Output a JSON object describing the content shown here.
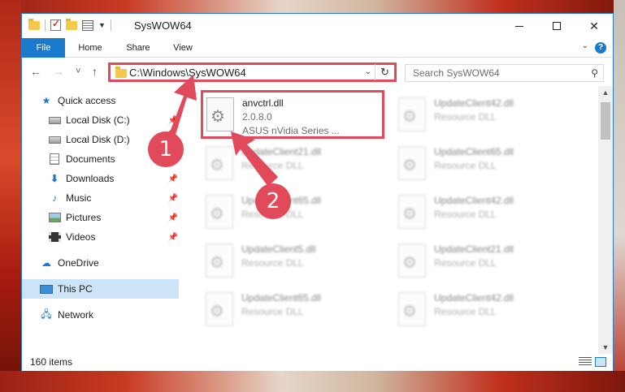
{
  "window": {
    "title": "SysWOW64",
    "minimize_glyph": "",
    "maximize_glyph": "",
    "close_glyph": "✕"
  },
  "ribbon": {
    "tabs": [
      "File",
      "Home",
      "Share",
      "View"
    ],
    "help_glyph": "?"
  },
  "navigation": {
    "back_glyph": "←",
    "forward_glyph": "→",
    "recent_glyph": "˅",
    "up_glyph": "↑",
    "address_path": "C:\\Windows\\SysWOW64",
    "refresh_glyph": "↻",
    "search_placeholder": "Search SysWOW64"
  },
  "sidebar": {
    "items": [
      {
        "label": "Quick access",
        "icon": "star-icon",
        "pinned": false
      },
      {
        "label": "Local Disk (C:)",
        "icon": "disk-icon",
        "pinned": true
      },
      {
        "label": "Local Disk (D:)",
        "icon": "disk-icon",
        "pinned": true
      },
      {
        "label": "Documents",
        "icon": "documents-icon",
        "pinned": true
      },
      {
        "label": "Downloads",
        "icon": "downloads-icon",
        "pinned": true
      },
      {
        "label": "Music",
        "icon": "music-icon",
        "pinned": true
      },
      {
        "label": "Pictures",
        "icon": "pictures-icon",
        "pinned": true
      },
      {
        "label": "Videos",
        "icon": "videos-icon",
        "pinned": true
      },
      {
        "label": "OneDrive",
        "icon": "onedrive-icon",
        "pinned": false
      },
      {
        "label": "This PC",
        "icon": "this-pc-icon",
        "pinned": false,
        "selected": true
      },
      {
        "label": "Network",
        "icon": "network-icon",
        "pinned": false
      }
    ]
  },
  "files": [
    {
      "name": "anvctrl.dll",
      "line2": "2.0.8.0",
      "line3": "ASUS nVidia Series ...",
      "highlighted": true
    },
    {
      "name": "UpdateClient42.dll",
      "line2": "Resource DLL"
    },
    {
      "name": "UpdateClient21.dll",
      "line2": "Resource DLL"
    },
    {
      "name": "UpdateClient65.dll",
      "line2": "Resource DLL"
    },
    {
      "name": "UpdateClient65.dll",
      "line2": "Resource DLL"
    },
    {
      "name": "UpdateClient42.dll",
      "line2": "Resource DLL"
    },
    {
      "name": "UpdateClient5.dll",
      "line2": "Resource DLL"
    },
    {
      "name": "UpdateClient21.dll",
      "line2": "Resource DLL"
    },
    {
      "name": "UpdateClient65.dll",
      "line2": "Resource DLL"
    },
    {
      "name": "UpdateClient42.dll",
      "line2": "Resource DLL"
    }
  ],
  "status": {
    "item_count": "160 items"
  },
  "annotations": {
    "step1": "1",
    "step2": "2",
    "color": "#e04a5a"
  }
}
